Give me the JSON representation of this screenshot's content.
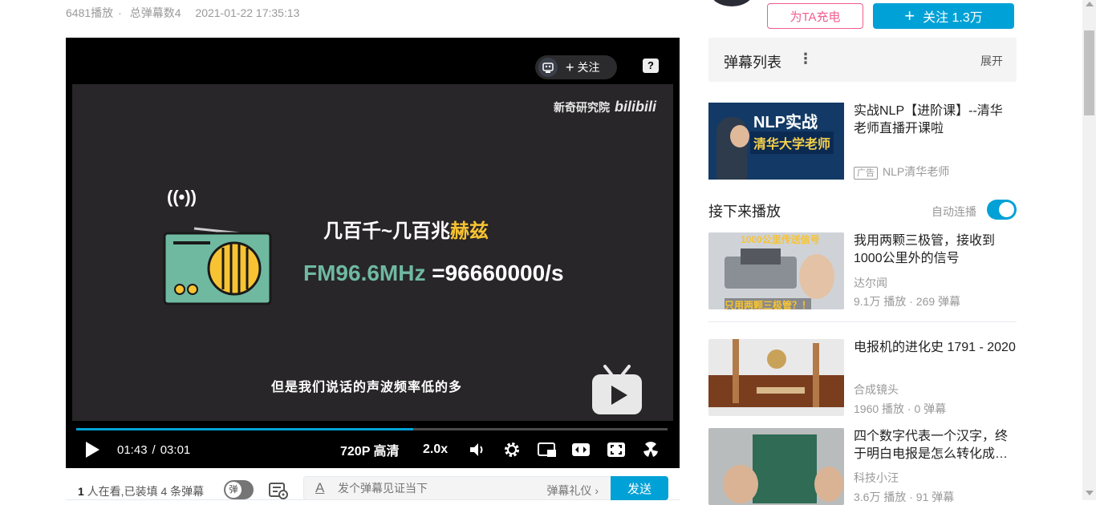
{
  "video_meta": {
    "plays": "6481播放",
    "danmaku_total": "总弹幕数4",
    "publish_time": "2021-01-22 17:35:13"
  },
  "player": {
    "follow_label": "关注",
    "watermark_channel": "新奇研究院",
    "watermark_brand": "bilibili",
    "frame_line1_text": "几百千~几百兆",
    "frame_line1_highlight": "赫兹",
    "frame_line2_green": "FM96.6MHz",
    "frame_line2_white": "=96660000/s",
    "subtitle": "但是我们说话的声波频率低的多",
    "progress": 0.57,
    "time_current": "01:43",
    "time_total": "03:01",
    "time_separator": "/",
    "quality": "720P 高清",
    "speed": "2.0x"
  },
  "danmaku_bar": {
    "watching_count": "1",
    "watching_text": " 人在看,已装填 ",
    "loaded_count": "4",
    "loaded_text": " 条弹幕",
    "toggle_label": "弹",
    "input_placeholder": "发个弹幕见证当下",
    "etiquette_label": "弹幕礼仪 ›",
    "send_label": "发送"
  },
  "uploader": {
    "charge_label": "为TA充电",
    "follow_label": "关注 1.3万"
  },
  "danmaku_list": {
    "title": "弹幕列表",
    "expand_label": "展开"
  },
  "ad": {
    "title": "实战NLP【进阶课】--清华老师直播开课啦",
    "tag": "广告",
    "author": "NLP清华老师",
    "thumb_line1": "NLP实战",
    "thumb_line2": "清华大学老师"
  },
  "next_up": {
    "title": "接下来播放",
    "autoplay_label": "自动连播",
    "autoplay_on": true
  },
  "recommendations": [
    {
      "title": "我用两颗三极管，接收到1000公里外的信号",
      "up": "达尔闻",
      "stats": "9.1万 播放 · 269 弹幕",
      "thumb_top": "1000公里传送信号",
      "thumb_bottom": "只用两颗三极管？！"
    },
    {
      "title": "电报机的进化史 1791 - 2020",
      "up": "合成镜头",
      "stats": "1960 播放 · 0 弹幕"
    },
    {
      "title": "四个数字代表一个汉字，终于明白电报是怎么转化成…",
      "up": "科技小汪",
      "stats": "3.6万 播放 · 91 弹幕"
    }
  ],
  "colors": {
    "accent_blue": "#00a1d6",
    "charge_pink": "#f25d8e",
    "frame_bg": "#282628",
    "frame_yellow": "#f7c332",
    "frame_green": "#6fb9a1"
  }
}
